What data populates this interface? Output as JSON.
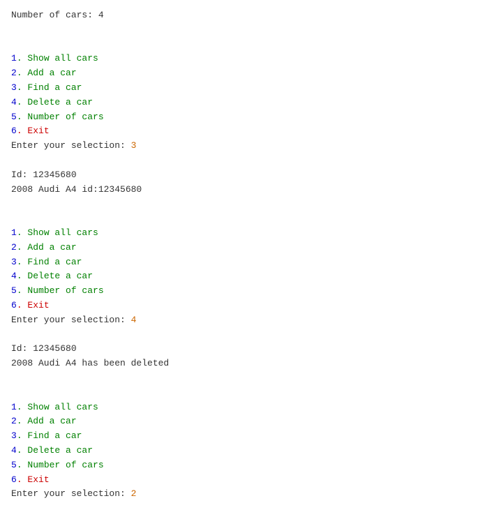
{
  "terminal": {
    "sections": [
      {
        "id": "section-0",
        "lines": [
          {
            "text": "Number of cars: 4",
            "color": "dark",
            "type": "output"
          }
        ]
      },
      {
        "id": "section-1",
        "menu": [
          {
            "number": "1",
            "label": ". Show all cars",
            "numColor": "blue",
            "labelColor": "green"
          },
          {
            "number": "2",
            "label": ". Add a car",
            "numColor": "blue",
            "labelColor": "green"
          },
          {
            "number": "3",
            "label": ". Find a car",
            "numColor": "blue",
            "labelColor": "green"
          },
          {
            "number": "4",
            "label": ". Delete a car",
            "numColor": "blue",
            "labelColor": "green"
          },
          {
            "number": "5",
            "label": ". Number of cars",
            "numColor": "blue",
            "labelColor": "green"
          },
          {
            "number": "6",
            "label": ". Exit",
            "numColor": "blue",
            "labelColor": "red"
          }
        ],
        "prompt": "Enter your selection: ",
        "selection": "3",
        "selectionColor": "orange"
      },
      {
        "id": "section-2",
        "lines": [
          {
            "text": "Id: 12345680",
            "color": "dark"
          },
          {
            "text": "2008 Audi A4 id:12345680",
            "color": "dark"
          }
        ]
      },
      {
        "id": "section-3",
        "menu": [
          {
            "number": "1",
            "label": ". Show all cars",
            "numColor": "blue",
            "labelColor": "green"
          },
          {
            "number": "2",
            "label": ". Add a car",
            "numColor": "blue",
            "labelColor": "green"
          },
          {
            "number": "3",
            "label": ". Find a car",
            "numColor": "blue",
            "labelColor": "green"
          },
          {
            "number": "4",
            "label": ". Delete a car",
            "numColor": "blue",
            "labelColor": "green"
          },
          {
            "number": "5",
            "label": ". Number of cars",
            "numColor": "blue",
            "labelColor": "green"
          },
          {
            "number": "6",
            "label": ". Exit",
            "numColor": "blue",
            "labelColor": "red"
          }
        ],
        "prompt": "Enter your selection: ",
        "selection": "4",
        "selectionColor": "orange"
      },
      {
        "id": "section-4",
        "lines": [
          {
            "text": "Id: 12345680",
            "color": "dark"
          },
          {
            "text": "2008 Audi A4 has been deleted",
            "color": "dark"
          }
        ]
      },
      {
        "id": "section-5",
        "menu": [
          {
            "number": "1",
            "label": ". Show all cars",
            "numColor": "blue",
            "labelColor": "green"
          },
          {
            "number": "2",
            "label": ". Add a car",
            "numColor": "blue",
            "labelColor": "green"
          },
          {
            "number": "3",
            "label": ". Find a car",
            "numColor": "blue",
            "labelColor": "green"
          },
          {
            "number": "4",
            "label": ". Delete a car",
            "numColor": "blue",
            "labelColor": "green"
          },
          {
            "number": "5",
            "label": ". Number of cars",
            "numColor": "blue",
            "labelColor": "green"
          },
          {
            "number": "6",
            "label": ". Exit",
            "numColor": "blue",
            "labelColor": "red"
          }
        ],
        "prompt": "Enter your selection: ",
        "selection": "2",
        "selectionColor": "orange"
      }
    ]
  }
}
